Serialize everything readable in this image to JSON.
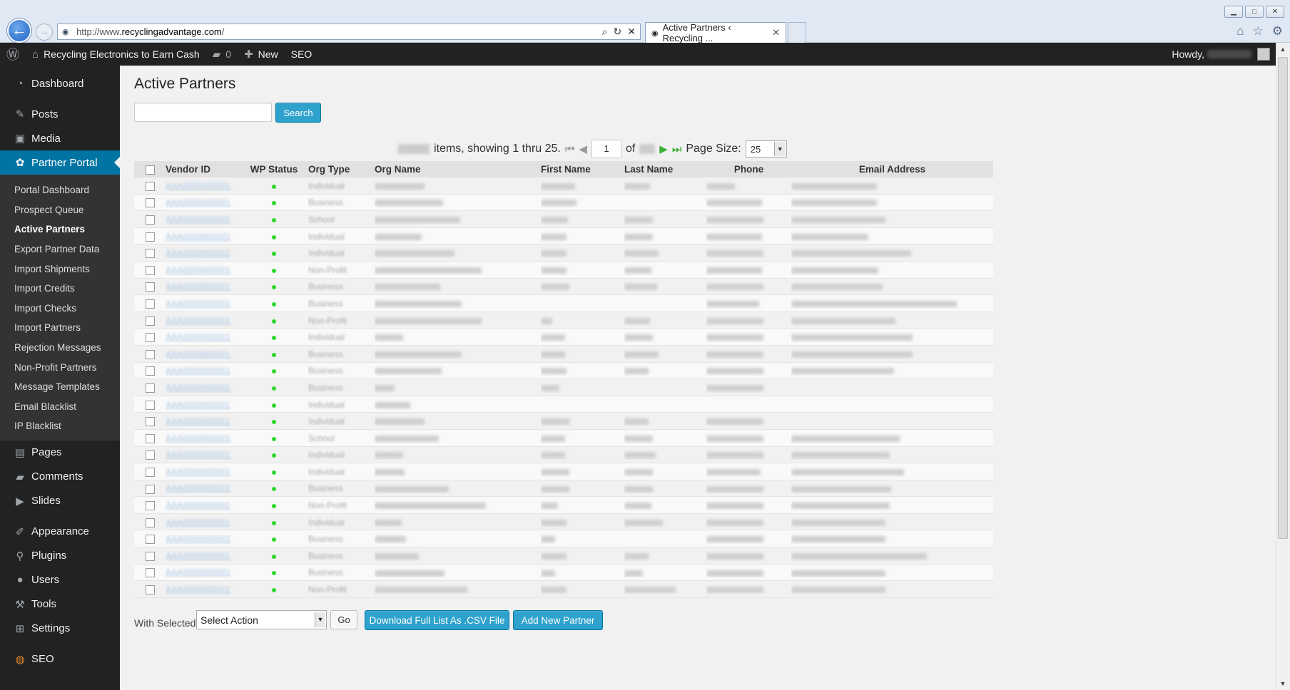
{
  "browser": {
    "url_prefix": "http://www.",
    "url_host": "recyclingadvantage.com",
    "url_suffix": "/",
    "tab_title": "Active Partners ‹ Recycling ...",
    "tab_close": "✕",
    "back": "←",
    "forward": "→",
    "icons": [
      "home-icon",
      "star-icon",
      "gear-icon"
    ]
  },
  "adminbar": {
    "site_name": "Recycling Electronics to Earn Cash",
    "comments_count": "0",
    "new_label": "New",
    "seo_label": "SEO",
    "howdy": "Howdy,"
  },
  "sidebar": {
    "top": [
      {
        "label": "Dashboard",
        "icon": "dashboard-icon"
      },
      {
        "label": "Posts",
        "icon": "pin-icon"
      },
      {
        "label": "Media",
        "icon": "media-icon"
      },
      {
        "label": "Partner Portal",
        "icon": "partners-icon"
      }
    ],
    "submenu": [
      "Portal Dashboard",
      "Prospect Queue",
      "Active Partners",
      "Export Partner Data",
      "Import Shipments",
      "Import Credits",
      "Import Checks",
      "Import Partners",
      "Rejection Messages",
      "Non-Profit Partners",
      "Message Templates",
      "Email Blacklist",
      "IP Blacklist"
    ],
    "bottom": [
      {
        "label": "Pages",
        "icon": "pages-icon"
      },
      {
        "label": "Comments",
        "icon": "comments-icon"
      },
      {
        "label": "Slides",
        "icon": "slides-icon"
      },
      {
        "label": "Appearance",
        "icon": "appearance-icon"
      },
      {
        "label": "Plugins",
        "icon": "plugins-icon"
      },
      {
        "label": "Users",
        "icon": "users-icon"
      },
      {
        "label": "Tools",
        "icon": "tools-icon"
      },
      {
        "label": "Settings",
        "icon": "settings-icon"
      },
      {
        "label": "SEO",
        "icon": "seo-icon"
      }
    ]
  },
  "main": {
    "title": "Active Partners",
    "search_button": "Search",
    "pager": {
      "items_text": "items, showing 1 thru 25.",
      "page": "1",
      "of": "of",
      "page_size_label": "Page Size:",
      "page_size": "25"
    },
    "columns": [
      "Vendor ID",
      "WP Status",
      "Org Type",
      "Org Name",
      "First Name",
      "Last Name",
      "Phone",
      "Email Address"
    ],
    "rows": [
      {
        "type": "Individual"
      },
      {
        "type": "Business"
      },
      {
        "type": "School"
      },
      {
        "type": "Individual"
      },
      {
        "type": "Individual"
      },
      {
        "type": "Non-Profit"
      },
      {
        "type": "Business"
      },
      {
        "type": "Business"
      },
      {
        "type": "Non-Profit"
      },
      {
        "type": "Individual"
      },
      {
        "type": "Business"
      },
      {
        "type": "Business"
      },
      {
        "type": "Business"
      },
      {
        "type": "Individual"
      },
      {
        "type": "Individual"
      },
      {
        "type": "School"
      },
      {
        "type": "Individual"
      },
      {
        "type": "Individual"
      },
      {
        "type": "Business"
      },
      {
        "type": "Non-Profit"
      },
      {
        "type": "Individual"
      },
      {
        "type": "Business"
      },
      {
        "type": "Business"
      },
      {
        "type": "Business"
      },
      {
        "type": "Non-Profit"
      }
    ],
    "status_color": "#2fd62f",
    "bulk": {
      "with_selected": "With Selected",
      "select_placeholder": "Select Action",
      "go": "Go",
      "csv": "Download Full List As .CSV File",
      "add_new": "Add New Partner"
    }
  }
}
